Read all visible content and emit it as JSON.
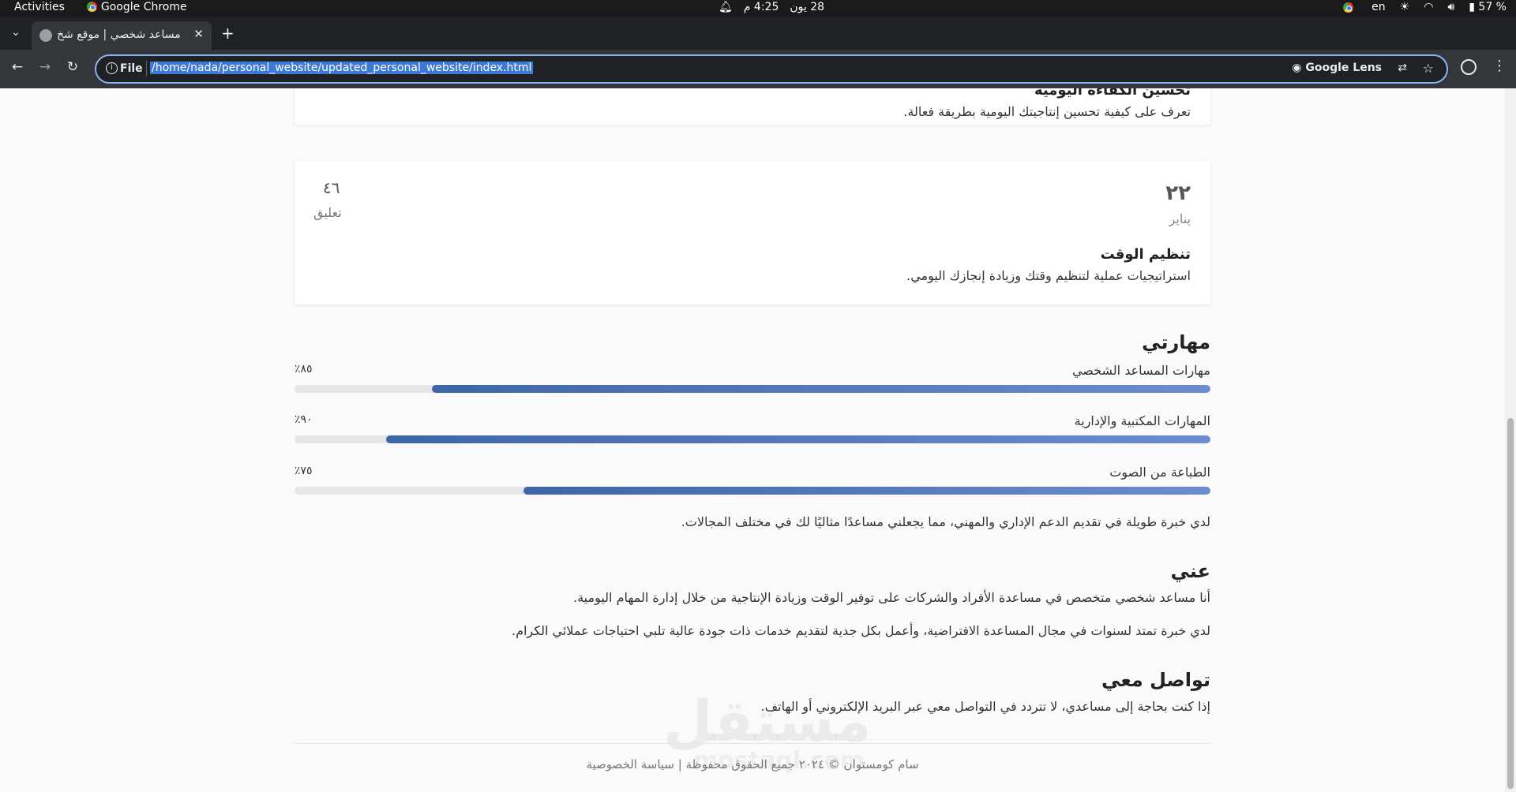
{
  "system_bar": {
    "activities": "Activities",
    "app_name": "Google Chrome",
    "date": "28 يون",
    "time": "4:25 م",
    "language": "en",
    "battery": "57 %"
  },
  "browser": {
    "tab_title": "مساعد شخصي | موقع شخ",
    "scheme": "File",
    "url": "/home/nada/personal_website/updated_personal_website/index.html",
    "lens_label": "Google Lens"
  },
  "posts": [
    {
      "title": "تحسين الكفاءة اليومية",
      "excerpt": "تعرف على كيفية تحسين إنتاجيتك اليومية بطريقة فعالة."
    },
    {
      "day": "٢٢",
      "month": "يناير",
      "comments_count": "٤٦",
      "comments_label": "تعليق",
      "title": "تنظيم الوقت",
      "excerpt": "استراتيجيات عملية لتنظيم وقتك وزيادة إنجازك اليومي."
    }
  ],
  "skills": {
    "title": "مهارتي",
    "items": [
      {
        "name": "مهارات المساعد الشخصي",
        "percent_label": "٨٥٪",
        "value": 0.85
      },
      {
        "name": "المهارات المكتبية والإدارية",
        "percent_label": "٩٠٪",
        "value": 0.9
      },
      {
        "name": "الطباعة من الصوت",
        "percent_label": "٧٥٪",
        "value": 0.75
      }
    ],
    "summary": "لدي خبرة طويلة في تقديم الدعم الإداري والمهني، مما يجعلني مساعدًا مثاليًا لك في مختلف المجالات."
  },
  "about": {
    "title": "عني",
    "p1": "أنا مساعد شخصي متخصص في مساعدة الأفراد والشركات على توفير الوقت وزيادة الإنتاجية من خلال إدارة المهام اليومية.",
    "p2": "لدي خبرة تمتد لسنوات في مجال المساعدة الافتراضية، وأعمل بكل جدية لتقديم خدمات ذات جودة عالية تلبي احتياجات عملائي الكرام."
  },
  "contact": {
    "title": "تواصل معي",
    "text": "إذا كنت بحاجة إلى مساعدي، لا تتردد في التواصل معي عبر البريد الإلكتروني أو الهاتف."
  },
  "footer": {
    "text": "سام كومستوان © ٢٠٢٤ جميع الحقوق محفوظة | سياسة الخصوصية"
  },
  "watermark": {
    "arabic": "مستقل",
    "latin": "mostaql.com"
  }
}
